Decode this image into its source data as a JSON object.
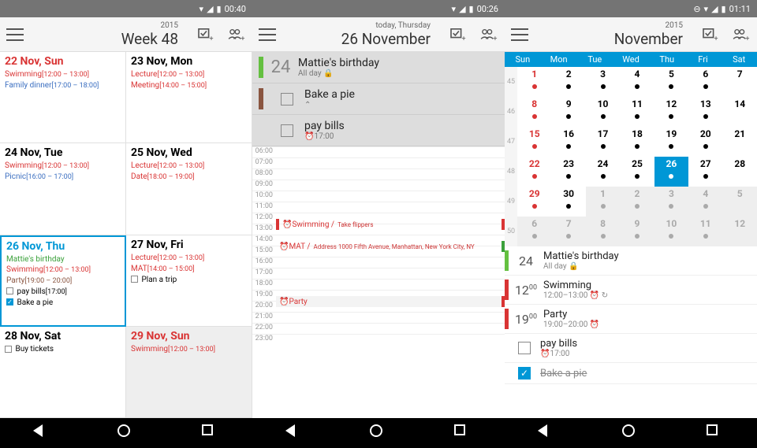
{
  "phones": [
    {
      "status_time": "00:40",
      "sub": "2015",
      "title": "Week 48"
    },
    {
      "status_time": "00:26",
      "sub": "today, Thursday",
      "title": "26 November"
    },
    {
      "status_time": "01:11",
      "sub": "2015",
      "title": "November"
    }
  ],
  "week": {
    "days": [
      {
        "head": "22 Nov, Sun",
        "cls": "red",
        "events": [
          {
            "txt": "Swimming",
            "time": "[12:00 – 13:00]",
            "c": "ev-red"
          },
          {
            "txt": "Family dinner",
            "time": "[17:00 – 18:00]",
            "c": "ev-blue"
          }
        ]
      },
      {
        "head": "23 Nov, Mon",
        "events": [
          {
            "txt": "Lecture",
            "time": "[12:00 – 13:00]",
            "c": "ev-red"
          },
          {
            "txt": "Meeting",
            "time": "[14:00 – 15:00]",
            "c": "ev-red"
          }
        ]
      },
      {
        "head": "24 Nov, Tue",
        "events": [
          {
            "txt": "Swimming",
            "time": "[12:00 – 13:00]",
            "c": "ev-red"
          },
          {
            "txt": "Picnic",
            "time": "[16:00 – 17:00]",
            "c": "ev-blue"
          }
        ]
      },
      {
        "head": "25 Nov, Wed",
        "events": [
          {
            "txt": "Lecture",
            "time": "[12:00 – 13:00]",
            "c": "ev-red"
          },
          {
            "txt": "Date",
            "time": "[18:00 – 19:00]",
            "c": "ev-red"
          }
        ]
      },
      {
        "head": "26 Nov, Thu",
        "cls": "today-c",
        "today": true,
        "events": [
          {
            "txt": "Mattie's birthday",
            "c": "ev-green"
          },
          {
            "txt": "Swimming",
            "time": "[12:00 – 13:00]",
            "c": "ev-red"
          },
          {
            "txt": "Party",
            "time": "[19:00 – 20:00]",
            "c": "ev-brown"
          },
          {
            "txt": "pay bills",
            "time": "[17:00]",
            "cb": true
          },
          {
            "txt": "Bake a pie",
            "cb": true,
            "ck": true
          }
        ]
      },
      {
        "head": "27 Nov, Fri",
        "events": [
          {
            "txt": "Lecture",
            "time": "[12:00 – 13:00]",
            "c": "ev-red"
          },
          {
            "txt": "MAT",
            "time": "[14:00 – 15:00]",
            "c": "ev-red"
          },
          {
            "txt": "Plan a trip",
            "cb": true
          }
        ]
      },
      {
        "head": "28 Nov, Sat",
        "events": [
          {
            "txt": "Buy tickets",
            "cb": true
          }
        ]
      },
      {
        "head": "29 Nov, Sun",
        "cls": "red",
        "dim": true,
        "events": [
          {
            "txt": "Swimming",
            "time": "[12:00 – 13:00]",
            "c": "ev-red"
          }
        ]
      }
    ]
  },
  "day": {
    "num": "24",
    "allday": {
      "title": "Mattie's birthday",
      "sub": "All day 🔒",
      "bar": "#64c040"
    },
    "tasks": [
      {
        "title": "Bake a pie",
        "sub": "⌃",
        "bar": "#8a5540"
      },
      {
        "title": "pay bills",
        "sub": "⏰17:00",
        "bar": ""
      }
    ],
    "hours": [
      "06:00",
      "07:00",
      "08:00",
      "09:00",
      "10:00",
      "11:00",
      "12:00",
      "13:00",
      "14:00",
      "15:00",
      "16:00",
      "17:00",
      "18:00",
      "19:00",
      "20:00",
      "21:00",
      "22:00",
      "23:00"
    ],
    "timed": {
      "swim": {
        "txt": "Swimming /",
        "sub": "Take flippers"
      },
      "mat": {
        "txt": "MAT /",
        "sub": "Address 1000 Fifth Avenue, Manhattan, New York City, NY"
      },
      "party": {
        "txt": "Party"
      }
    }
  },
  "month": {
    "dow": [
      "Sun",
      "Mon",
      "Tue",
      "Wed",
      "Thu",
      "Fri",
      "Sat"
    ],
    "weeks": [
      {
        "n": "45",
        "d": [
          {
            "v": "1",
            "r": 1,
            "dot": "red"
          },
          {
            "v": "2",
            "dot": 1
          },
          {
            "v": "3",
            "dot": 1
          },
          {
            "v": "4",
            "dot": 1
          },
          {
            "v": "5",
            "dot": 1
          },
          {
            "v": "6",
            "dot": 1
          },
          {
            "v": "7"
          }
        ]
      },
      {
        "n": "46",
        "d": [
          {
            "v": "8",
            "r": 1,
            "dot": "red"
          },
          {
            "v": "9",
            "dot": 1
          },
          {
            "v": "10",
            "dot": 1
          },
          {
            "v": "11",
            "dot": 1
          },
          {
            "v": "12",
            "dot": 1
          },
          {
            "v": "13",
            "dot": 1
          },
          {
            "v": "14"
          }
        ]
      },
      {
        "n": "47",
        "d": [
          {
            "v": "15",
            "r": 1,
            "dot": "red"
          },
          {
            "v": "16",
            "dot": 1
          },
          {
            "v": "17",
            "dot": 1
          },
          {
            "v": "18",
            "dot": 1
          },
          {
            "v": "19",
            "dot": 1
          },
          {
            "v": "20",
            "dot": 1
          },
          {
            "v": "21"
          }
        ]
      },
      {
        "n": "48",
        "d": [
          {
            "v": "22",
            "r": 1,
            "dot": "red"
          },
          {
            "v": "23",
            "dot": 1
          },
          {
            "v": "24",
            "dot": 1
          },
          {
            "v": "25",
            "dot": 1
          },
          {
            "v": "26",
            "sel": 1,
            "dot": 1
          },
          {
            "v": "27",
            "dot": 1
          },
          {
            "v": "28"
          }
        ]
      },
      {
        "n": "49",
        "d": [
          {
            "v": "29",
            "r": 1,
            "dot": "red"
          },
          {
            "v": "30",
            "dot": 1
          },
          {
            "v": "1",
            "dim": 1,
            "dot": "grey"
          },
          {
            "v": "2",
            "dim": 1,
            "dot": "grey"
          },
          {
            "v": "3",
            "dim": 1,
            "dot": "grey"
          },
          {
            "v": "4",
            "dim": 1,
            "dot": "grey"
          },
          {
            "v": "5",
            "dim": 1
          }
        ]
      },
      {
        "n": "50",
        "d": [
          {
            "v": "6",
            "dim": 1,
            "dot": "grey"
          },
          {
            "v": "7",
            "dim": 1,
            "dot": "grey"
          },
          {
            "v": "8",
            "dim": 1,
            "dot": "grey"
          },
          {
            "v": "9",
            "dim": 1,
            "dot": "grey"
          },
          {
            "v": "10",
            "dim": 1,
            "dot": "grey"
          },
          {
            "v": "11",
            "dim": 1,
            "dot": "grey"
          },
          {
            "v": "12",
            "dim": 1
          }
        ]
      }
    ],
    "agenda": [
      {
        "bar": "#64c040",
        "time": "24",
        "title": "Mattie's birthday",
        "sub": "All day 🔒"
      },
      {
        "bar": "#d93434",
        "time": "12",
        "min": "00",
        "title": "Swimming",
        "sub": "12:00–13:00 ⏰ ↻"
      },
      {
        "bar": "#d93434",
        "time": "19",
        "min": "00",
        "title": "Party",
        "sub": "19:00–20:00 ⏰"
      },
      {
        "bar": "",
        "cb": 1,
        "title": "pay bills",
        "sub": "⏰17:00"
      },
      {
        "bar": "",
        "cb": 1,
        "ck": 1,
        "title": "Bake a pie",
        "strike": 1
      }
    ]
  }
}
